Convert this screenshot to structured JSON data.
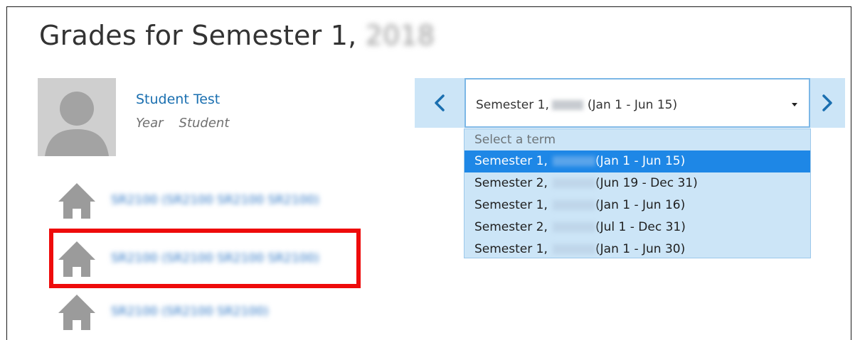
{
  "page": {
    "title": "Grades for Semester 1,",
    "title_year_blurred": "2018"
  },
  "student": {
    "name": "Student Test",
    "meta_year": "Year",
    "meta_role": "Student"
  },
  "schools": [
    {
      "label": "SR2100 (SR2100 SR2100 SR2100)"
    },
    {
      "label": "SR2100 (SR2100 SR2100 SR2100)"
    },
    {
      "label": "SR2100 (SR2100 SR2100)"
    }
  ],
  "term_selector": {
    "selected_prefix": "Semester 1,",
    "selected_suffix": "(Jan 1 - Jun 15)",
    "placeholder": "Select a term",
    "options": [
      {
        "prefix": "Semester 1,",
        "suffix": "(Jan 1 - Jun 15)",
        "selected": true
      },
      {
        "prefix": "Semester 2,",
        "suffix": "(Jun 19 - Dec 31)",
        "selected": false
      },
      {
        "prefix": "Semester 1,",
        "suffix": "(Jan 1 - Jun 16)",
        "selected": false
      },
      {
        "prefix": "Semester 2,",
        "suffix": "(Jul 1 - Dec 31)",
        "selected": false
      },
      {
        "prefix": "Semester 1,",
        "suffix": "(Jan 1 - Jun 30)",
        "selected": false
      }
    ]
  },
  "colors": {
    "accent": "#1e87e6",
    "nav_icon": "#1a6fb0",
    "highlight": "#ee0b0b",
    "icon_gray": "#9b9b9b",
    "dropdown_bg": "#cce5f7"
  },
  "icons": {
    "prev": "chevron-left-icon",
    "next": "chevron-right-icon",
    "school": "house-icon",
    "avatar": "user-silhouette-icon",
    "dropdown": "caret-down-icon"
  }
}
